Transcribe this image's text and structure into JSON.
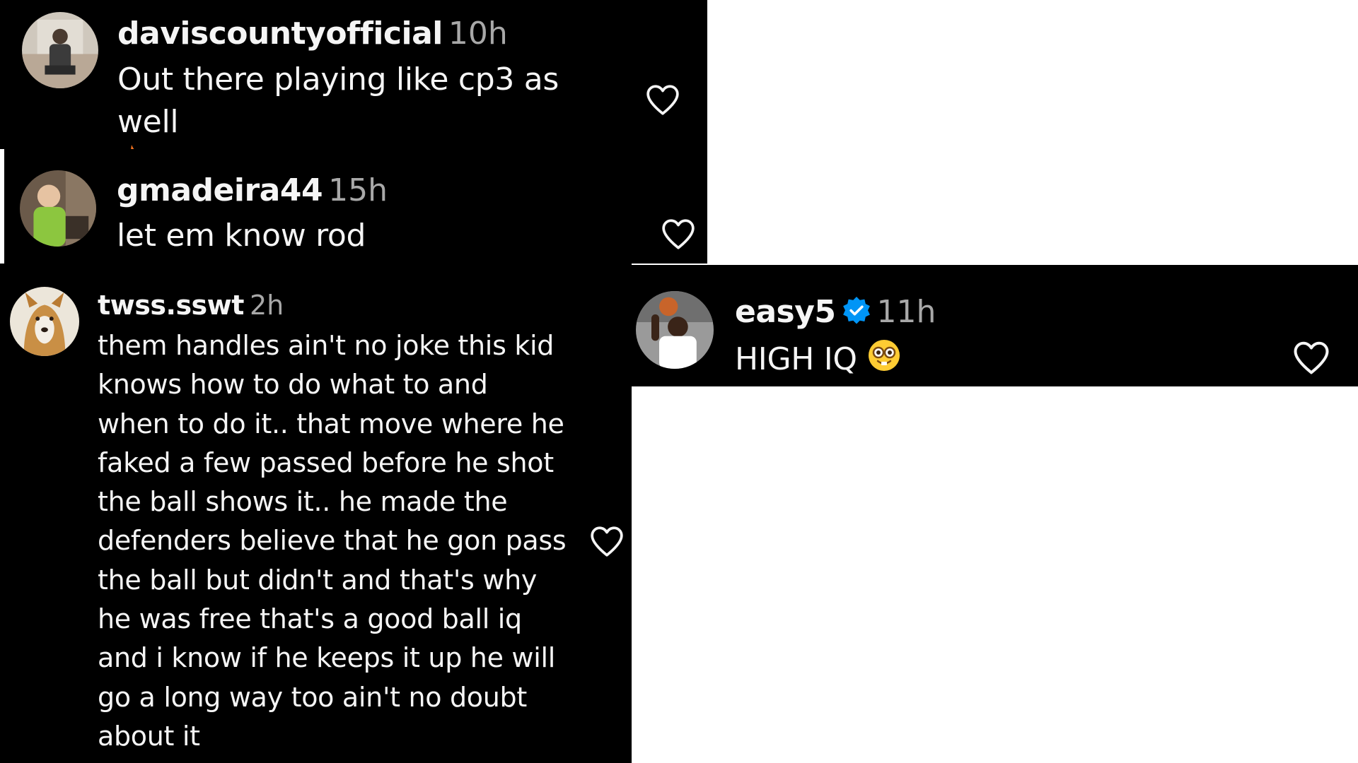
{
  "comments": [
    {
      "username": "daviscountyofficial",
      "time": "10h",
      "text": "Out there playing like cp3 as well",
      "emoji": "fire-emoji",
      "verified": false,
      "liked": false
    },
    {
      "username": "gmadeira44",
      "time": "15h",
      "text": "let em know rod",
      "verified": false,
      "liked": false
    },
    {
      "username": "twss.sswt",
      "time": "2h",
      "text_lines": [
        "them handles ain't no joke this kid",
        "knows how to do what to and",
        "when to do it.. that move where he",
        "faked a few passed before he shot",
        "the ball shows it.. he made the",
        "defenders believe that he gon pass",
        "the ball but didn't and that's why",
        "he was free that's a good ball iq",
        "and i know if he keeps it up he will",
        "go a long way too ain't no doubt",
        "about it"
      ],
      "verified": false,
      "liked": false
    },
    {
      "username": "easy5",
      "time": "11h",
      "text": "HIGH IQ",
      "emoji": "nerd-face-emoji",
      "verified": true,
      "liked": false
    }
  ],
  "colors": {
    "background": "#000000",
    "text": "#f5f5f5",
    "timestamp": "#a8a8a8",
    "verified": "#0095f6",
    "canvas": "#ffffff"
  },
  "icons": {
    "like": "heart-outline-icon",
    "verified": "verified-badge-icon"
  }
}
